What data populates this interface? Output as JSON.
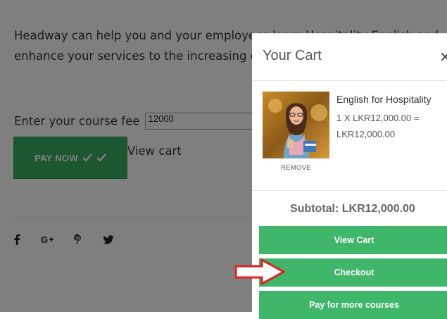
{
  "page": {
    "intro_line1": "Headway can help you and your employees learn Hospitality English and",
    "intro_line2": "enhance your services to the increasing demand of tourists",
    "fee_label": "Enter your course fee",
    "fee_value": "12000",
    "pay_now_label": "PAY NOW",
    "view_cart_link": "View cart",
    "social_icons": [
      "facebook-icon",
      "google-plus-icon",
      "pinterest-icon",
      "twitter-icon"
    ],
    "social_glyphs": [
      "f",
      "G+",
      "P",
      "t"
    ]
  },
  "cart": {
    "title": "Your Cart",
    "close_glyph": "×",
    "item": {
      "name": "English for Hospitality",
      "line1": "1 X LKR12,000.00 =",
      "line2": "LKR12,000.00",
      "remove_label": "REMOVE"
    },
    "subtotal": "Subtotal: LKR12,000.00",
    "buttons": {
      "view_cart": "View Cart",
      "checkout": "Checkout",
      "pay_more": "Pay for more courses"
    }
  },
  "colors": {
    "green": "#3fb66a",
    "overlay": "rgba(0,0,0,0.5)",
    "arrow_red": "#e02020"
  }
}
